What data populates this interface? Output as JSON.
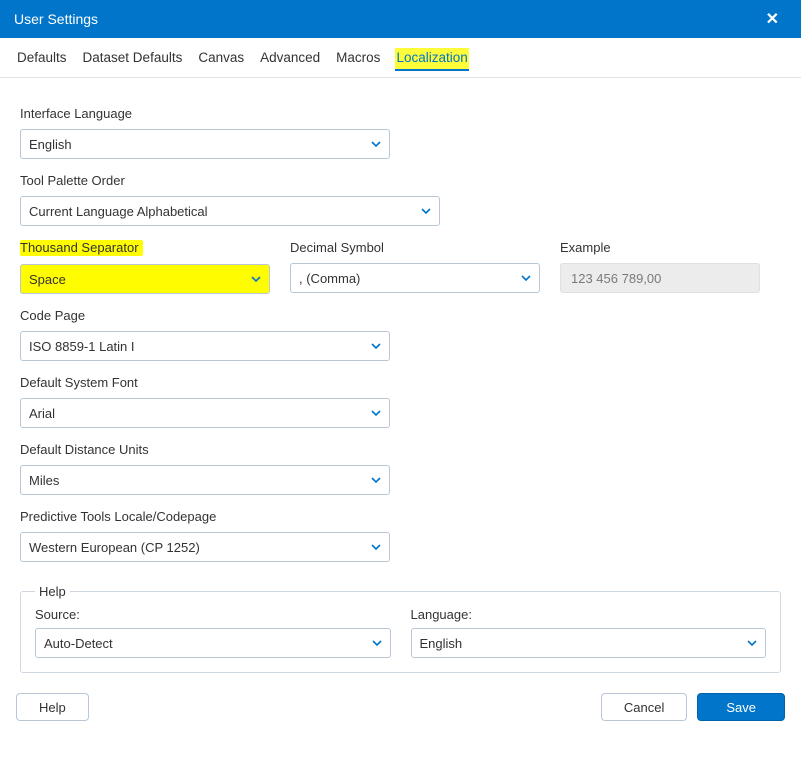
{
  "window": {
    "title": "User Settings"
  },
  "tabs": {
    "defaults": "Defaults",
    "dataset_defaults": "Dataset Defaults",
    "canvas": "Canvas",
    "advanced": "Advanced",
    "macros": "Macros",
    "localization": "Localization"
  },
  "labels": {
    "interface_language": "Interface Language",
    "tool_palette_order": "Tool Palette Order",
    "thousand_separator": "Thousand Separator",
    "decimal_symbol": "Decimal Symbol",
    "example": "Example",
    "code_page": "Code Page",
    "default_system_font": "Default System Font",
    "default_distance_units": "Default Distance Units",
    "predictive_locale": "Predictive Tools Locale/Codepage",
    "help_legend": "Help",
    "help_source": "Source:",
    "help_language": "Language:"
  },
  "values": {
    "interface_language": "English",
    "tool_palette_order": "Current Language Alphabetical",
    "thousand_separator": "Space",
    "decimal_symbol": ", (Comma)",
    "example": "123 456 789,00",
    "code_page": "ISO 8859-1 Latin I",
    "default_system_font": "Arial",
    "default_distance_units": "Miles",
    "predictive_locale": "Western European (CP 1252)",
    "help_source": "Auto-Detect",
    "help_language": "English"
  },
  "buttons": {
    "help": "Help",
    "cancel": "Cancel",
    "save": "Save"
  },
  "colors": {
    "accent": "#0075c9",
    "highlight": "#fffd00"
  }
}
